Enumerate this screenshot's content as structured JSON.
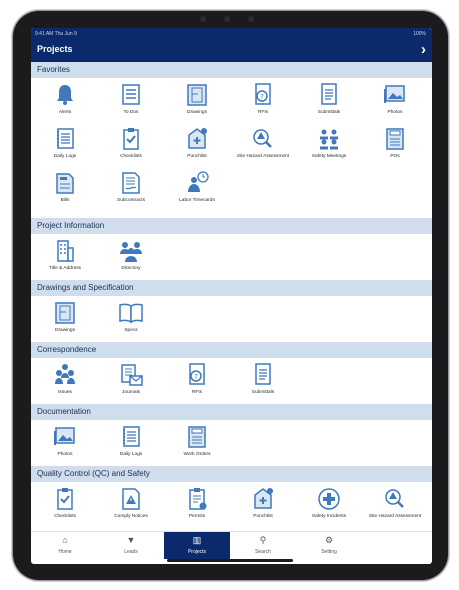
{
  "status_bar": {
    "time": "9:41 AM  Thu Jun 9",
    "right": "100%"
  },
  "header": {
    "title": "Projects",
    "chevron": "›"
  },
  "sections": [
    {
      "title": "Favorites",
      "items": [
        {
          "label": "Alerts",
          "icon": "bell-icon"
        },
        {
          "label": "To Dos",
          "icon": "todo-list-icon"
        },
        {
          "label": "Drawings",
          "icon": "drawings-icon"
        },
        {
          "label": "RFIs",
          "icon": "rfi-icon"
        },
        {
          "label": "Submittals",
          "icon": "submittals-icon"
        },
        {
          "label": "Photos",
          "icon": "photos-icon"
        },
        {
          "label": "Daily Logs",
          "icon": "daily-logs-icon"
        },
        {
          "label": "Checklists",
          "icon": "checklists-icon"
        },
        {
          "label": "Punchlist",
          "icon": "punchlist-icon"
        },
        {
          "label": "Site Hazard Assessment",
          "icon": "site-hazard-icon"
        },
        {
          "label": "Safety Meetings",
          "icon": "safety-meetings-icon"
        },
        {
          "label": "POs",
          "icon": "po-icon"
        },
        {
          "label": "Bills",
          "icon": "bills-icon"
        },
        {
          "label": "Subcontracts",
          "icon": "subcontracts-icon"
        },
        {
          "label": "Labor Timecards",
          "icon": "labor-timecards-icon"
        }
      ]
    },
    {
      "title": "Project Information",
      "items": [
        {
          "label": "Title & Address",
          "icon": "building-icon"
        },
        {
          "label": "Directory",
          "icon": "directory-icon"
        }
      ]
    },
    {
      "title": "Drawings and Specification",
      "items": [
        {
          "label": "Drawings",
          "icon": "drawings-icon"
        },
        {
          "label": "Specs",
          "icon": "specs-book-icon"
        }
      ]
    },
    {
      "title": "Correspondence",
      "items": [
        {
          "label": "Issues",
          "icon": "issues-icon"
        },
        {
          "label": "Journals",
          "icon": "journals-icon"
        },
        {
          "label": "RFIs",
          "icon": "rfi-icon"
        },
        {
          "label": "Submittals",
          "icon": "submittals-icon"
        }
      ]
    },
    {
      "title": "Documentation",
      "items": [
        {
          "label": "Photos",
          "icon": "photos-icon"
        },
        {
          "label": "Daily Logs",
          "icon": "daily-logs-icon"
        },
        {
          "label": "Work Orders",
          "icon": "work-orders-icon"
        }
      ]
    },
    {
      "title": "Quality Control (QC) and Safety",
      "items": [
        {
          "label": "Checklists",
          "icon": "checklists-icon"
        },
        {
          "label": "Comply Notices",
          "icon": "comply-notices-icon"
        },
        {
          "label": "Permits",
          "icon": "permits-icon"
        },
        {
          "label": "Punchlist",
          "icon": "punchlist-icon"
        },
        {
          "label": "Safety Incidents",
          "icon": "safety-incidents-icon"
        },
        {
          "label": "Site Hazard Assessment",
          "icon": "site-hazard-icon"
        }
      ]
    }
  ],
  "tabs": [
    {
      "label": "Home",
      "icon": "home-icon",
      "glyph": "⌂"
    },
    {
      "label": "Leads",
      "icon": "filter-icon",
      "glyph": "▼"
    },
    {
      "label": "Projects",
      "icon": "projects-icon",
      "glyph": "▥",
      "active": true
    },
    {
      "label": "Search",
      "icon": "search-icon",
      "glyph": "⚲"
    },
    {
      "label": "Setting",
      "icon": "gear-icon",
      "glyph": "⚙"
    }
  ],
  "colors": {
    "brand": "#0b2a6b",
    "section_bg": "#cfddec",
    "icon_blue": "#3f78bd"
  }
}
